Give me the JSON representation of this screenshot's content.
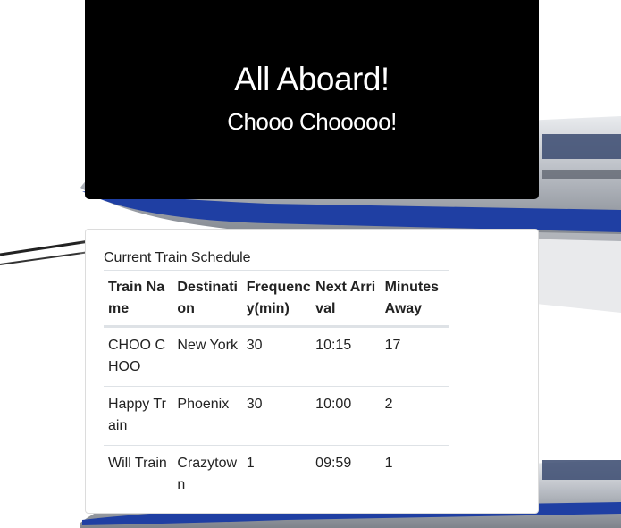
{
  "header": {
    "title": "All Aboard!",
    "subtitle": "Chooo Chooooo!"
  },
  "schedule": {
    "heading": "Current Train Schedule",
    "columns": [
      "Train Name",
      "Destination",
      "Frequency(min)",
      "Next Arrival",
      "Minutes Away"
    ],
    "rows": [
      [
        "CHOO CHOO",
        "New York",
        "30",
        "10:15",
        "17"
      ],
      [
        "Happy Train",
        "Phoenix",
        "30",
        "10:00",
        "2"
      ],
      [
        "Will Train",
        "Crazytown",
        "1",
        "09:59",
        "1"
      ]
    ]
  },
  "background": {
    "image": "bullet-train",
    "train_body_color": "#c9ccd1",
    "train_stripe_color": "#1f3fa3"
  }
}
